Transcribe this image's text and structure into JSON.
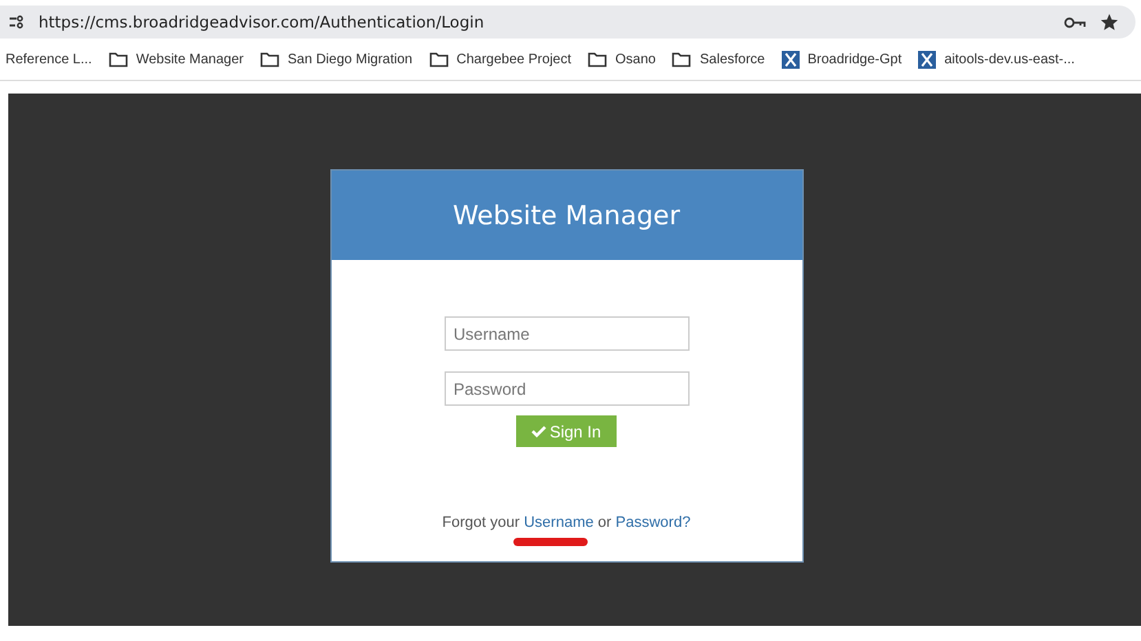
{
  "browser": {
    "url": "https://cms.broadridgeadvisor.com/Authentication/Login",
    "bookmarks": [
      {
        "label": "Reference L...",
        "kind": "plain"
      },
      {
        "label": "Website Manager",
        "kind": "folder"
      },
      {
        "label": "San Diego Migration",
        "kind": "folder"
      },
      {
        "label": "Chargebee Project",
        "kind": "folder"
      },
      {
        "label": "Osano",
        "kind": "folder"
      },
      {
        "label": "Salesforce",
        "kind": "folder"
      },
      {
        "label": "Broadridge-Gpt",
        "kind": "site"
      },
      {
        "label": "aitools-dev.us-east-...",
        "kind": "site"
      }
    ]
  },
  "login": {
    "title": "Website Manager",
    "username": {
      "placeholder": "Username"
    },
    "password": {
      "placeholder": "Password"
    },
    "button": "Sign In",
    "forgot": {
      "prefix": "Forgot your",
      "username_link": "Username",
      "middle": "or",
      "password_link": "Password?"
    }
  }
}
